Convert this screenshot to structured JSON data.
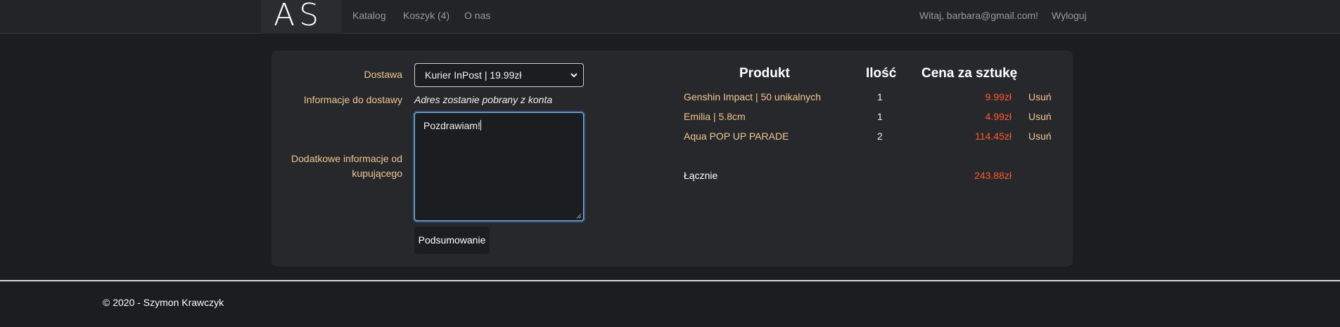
{
  "navbar": {
    "logo": "AS",
    "links": [
      "Katalog",
      "Koszyk (4)",
      "O nas"
    ],
    "greeting": "Witaj, barbara@gmail.com!",
    "logout": "Wyloguj"
  },
  "form": {
    "delivery_label": "Dostawa",
    "delivery_selected": "Kurier InPost | 19.99zł",
    "info_label": "Informacje do dostawy",
    "info_value": "Adres zostanie pobrany z konta",
    "extra_label_line1": "Dodatkowe informacje od",
    "extra_label_line2": "kupującego",
    "extra_value": "Pozdrawiam!",
    "summary_button": "Podsumowanie"
  },
  "cart": {
    "headers": {
      "product": "Produkt",
      "quantity": "Ilość",
      "price": "Cena za sztukę"
    },
    "rows": [
      {
        "name": "Genshin Impact | 50 unikalnych",
        "quantity": "1",
        "price": "9.99zł",
        "remove": "Usuń"
      },
      {
        "name": "Emilia | 5.8cm",
        "quantity": "1",
        "price": "4.99zł",
        "remove": "Usuń"
      },
      {
        "name": "Aqua POP UP PARADE",
        "quantity": "2",
        "price": "114.45zł",
        "remove": "Usuń"
      }
    ],
    "total_label": "Łącznie",
    "total_value": "243.88zł"
  },
  "footer": {
    "copyright": "© 2020 - Szymon Krawczyk"
  },
  "colors": {
    "background": "#1c1d20",
    "card": "#27282b",
    "label": "#f0c891",
    "price": "#ff5a2e",
    "focus": "#7fbdf0"
  },
  "icons": {
    "select_caret": "chevron-down-icon",
    "textarea_grip": "resize-grip-icon"
  }
}
